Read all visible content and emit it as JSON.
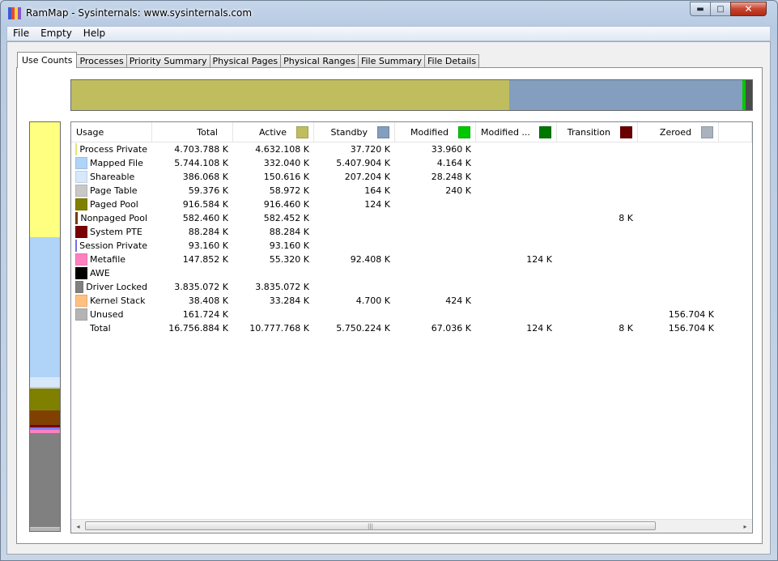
{
  "window": {
    "title": "RamMap - Sysinternals: www.sysinternals.com",
    "icon_colors": [
      "#3b5ccc",
      "#e04848",
      "#ffd23c",
      "#8a56c2"
    ]
  },
  "menu": [
    "File",
    "Empty",
    "Help"
  ],
  "tabs": [
    "Use Counts",
    "Processes",
    "Priority Summary",
    "Physical Pages",
    "Physical Ranges",
    "File Summary",
    "File Details"
  ],
  "horizontal_bar": [
    {
      "name": "Active",
      "color": "#bfbd5e",
      "percent": 64.3
    },
    {
      "name": "Standby",
      "color": "#839ebe",
      "percent": 34.3
    },
    {
      "name": "Modified",
      "color": "#00c800",
      "percent": 0.4
    },
    {
      "name": "Zeroed",
      "color": "#4a4a4a",
      "percent": 1.0
    }
  ],
  "vertical_bar": [
    {
      "name": "Process Private",
      "color": "#ffff80",
      "percent": 28.1
    },
    {
      "name": "Mapped File",
      "color": "#b0d4f8",
      "percent": 34.3
    },
    {
      "name": "Shareable",
      "color": "#d6e8fa",
      "percent": 2.3
    },
    {
      "name": "Page Table",
      "color": "#c8c8c8",
      "percent": 0.4
    },
    {
      "name": "Paged Pool",
      "color": "#808000",
      "percent": 5.5
    },
    {
      "name": "Nonpaged Pool",
      "color": "#804000",
      "percent": 3.5
    },
    {
      "name": "System PTE",
      "color": "#7a0000",
      "percent": 0.5
    },
    {
      "name": "Session Private",
      "color": "#7d7dff",
      "percent": 0.6
    },
    {
      "name": "Metafile",
      "color": "#ff80c0",
      "percent": 0.9
    },
    {
      "name": "Driver Locked",
      "color": "#808080",
      "percent": 22.9
    },
    {
      "name": "Kernel Stack",
      "color": "#ffc080",
      "percent": 0.2
    },
    {
      "name": "Unused",
      "color": "#b4b4b4",
      "percent": 0.8
    }
  ],
  "columns": [
    {
      "label": "Usage",
      "width": 100,
      "color": null
    },
    {
      "label": "Total",
      "width": 100,
      "color": null
    },
    {
      "label": "Active",
      "width": 100,
      "color": "#bfbd5e"
    },
    {
      "label": "Standby",
      "width": 100,
      "color": "#839ebe"
    },
    {
      "label": "Modified",
      "width": 100,
      "color": "#00c800"
    },
    {
      "label": "Modified ...",
      "width": 100,
      "color": "#007800"
    },
    {
      "label": "Transition",
      "width": 100,
      "color": "#6b0000"
    },
    {
      "label": "Zeroed",
      "width": 100,
      "color": "#aab3bd"
    },
    {
      "label": "",
      "width": 41,
      "color": null
    }
  ],
  "rows": [
    {
      "usage": "Process Private",
      "color": "#ffff80",
      "values": [
        "4.703.788 K",
        "4.632.108 K",
        "37.720 K",
        "33.960 K",
        "",
        "",
        ""
      ]
    },
    {
      "usage": "Mapped File",
      "color": "#b0d4f8",
      "values": [
        "5.744.108 K",
        "332.040 K",
        "5.407.904 K",
        "4.164 K",
        "",
        "",
        ""
      ]
    },
    {
      "usage": "Shareable",
      "color": "#d6e8fa",
      "values": [
        "386.068 K",
        "150.616 K",
        "207.204 K",
        "28.248 K",
        "",
        "",
        ""
      ]
    },
    {
      "usage": "Page Table",
      "color": "#c8c8c8",
      "values": [
        "59.376 K",
        "58.972 K",
        "164 K",
        "240 K",
        "",
        "",
        ""
      ]
    },
    {
      "usage": "Paged Pool",
      "color": "#808000",
      "values": [
        "916.584 K",
        "916.460 K",
        "124 K",
        "",
        "",
        "",
        ""
      ]
    },
    {
      "usage": "Nonpaged Pool",
      "color": "#804000",
      "values": [
        "582.460 K",
        "582.452 K",
        "",
        "",
        "",
        "8 K",
        ""
      ]
    },
    {
      "usage": "System PTE",
      "color": "#7a0000",
      "values": [
        "88.284 K",
        "88.284 K",
        "",
        "",
        "",
        "",
        ""
      ]
    },
    {
      "usage": "Session Private",
      "color": "#7d7dff",
      "values": [
        "93.160 K",
        "93.160 K",
        "",
        "",
        "",
        "",
        ""
      ]
    },
    {
      "usage": "Metafile",
      "color": "#ff80c0",
      "values": [
        "147.852 K",
        "55.320 K",
        "92.408 K",
        "",
        "124 K",
        "",
        ""
      ]
    },
    {
      "usage": "AWE",
      "color": "#000000",
      "values": [
        "",
        "",
        "",
        "",
        "",
        "",
        ""
      ]
    },
    {
      "usage": "Driver Locked",
      "color": "#808080",
      "values": [
        "3.835.072 K",
        "3.835.072 K",
        "",
        "",
        "",
        "",
        ""
      ]
    },
    {
      "usage": "Kernel Stack",
      "color": "#ffc080",
      "values": [
        "38.408 K",
        "33.284 K",
        "4.700 K",
        "424 K",
        "",
        "",
        ""
      ]
    },
    {
      "usage": "Unused",
      "color": "#b4b4b4",
      "values": [
        "161.724 K",
        "",
        "",
        "",
        "",
        "",
        "156.704 K"
      ]
    },
    {
      "usage": "Total",
      "color": null,
      "values": [
        "16.756.884 K",
        "10.777.768 K",
        "5.750.224 K",
        "67.036 K",
        "124 K",
        "8 K",
        "156.704 K"
      ]
    }
  ],
  "scrollbar": {
    "left_arrow": "◂",
    "right_arrow": "▸",
    "grip": "|||"
  }
}
